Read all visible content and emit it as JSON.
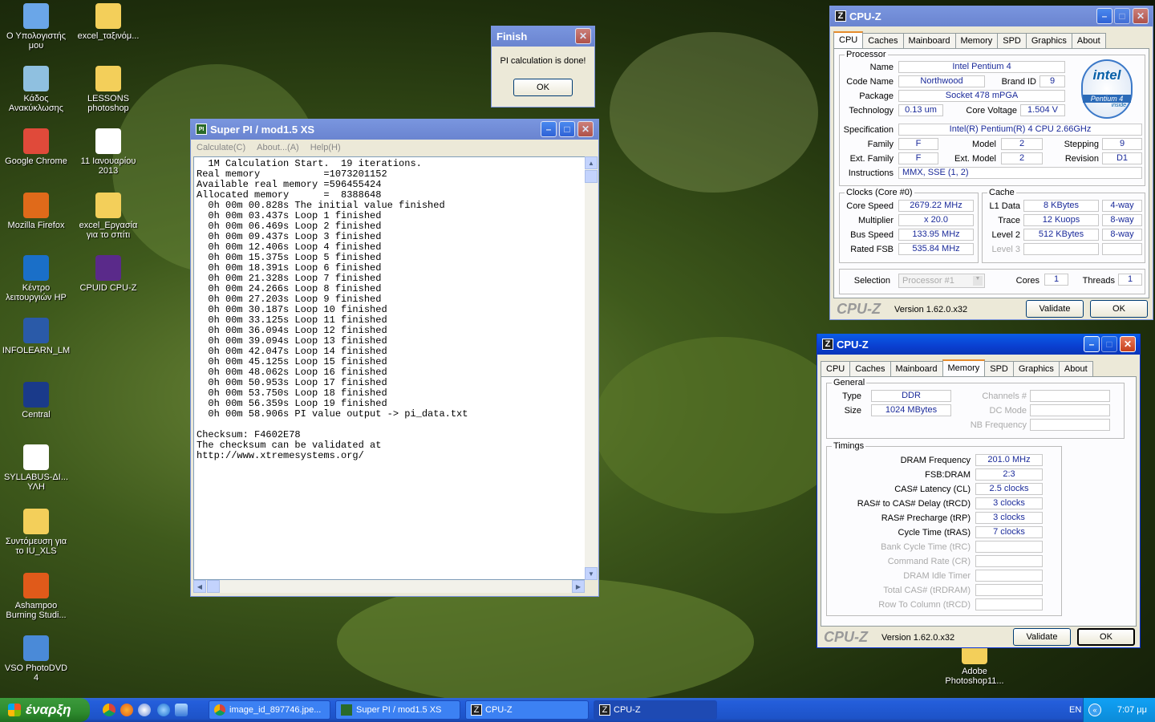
{
  "desktop_icons": [
    {
      "label": "Ο Υπολογιστής μου",
      "icon": "computer-icon",
      "color": "#6aa6e8"
    },
    {
      "label": "excel_ταξινόμ...",
      "icon": "folder-icon",
      "color": "#f3cf5a"
    },
    {
      "label": "Κάδος Ανακύκλωσης",
      "icon": "recycle-bin-icon",
      "color": "#8fc0e0"
    },
    {
      "label": "LESSONS photoshop",
      "icon": "folder-icon",
      "color": "#f3cf5a"
    },
    {
      "label": "Google Chrome",
      "icon": "chrome-icon",
      "color": "#e04a3a"
    },
    {
      "label": "11 Ιανουαρίου 2013",
      "icon": "pdf-icon",
      "color": "#ffffff"
    },
    {
      "label": "Mozilla Firefox",
      "icon": "firefox-icon",
      "color": "#e06a1a"
    },
    {
      "label": "excel_Εργασία για το σπίτι",
      "icon": "folder-icon",
      "color": "#f3cf5a"
    },
    {
      "label": "Κέντρο λειτουργιών HP",
      "icon": "hp-icon",
      "color": "#1a6fc8"
    },
    {
      "label": "CPUID CPU-Z",
      "icon": "cpuz-icon",
      "color": "#5a2a8a"
    },
    {
      "label": "INFOLEARN_LM",
      "icon": "plug-icon",
      "color": "#2a5aa8"
    },
    {
      "label": "Central",
      "icon": "star-icon",
      "color": "#1a3a8a"
    },
    {
      "label": "SYLLABUS-ΔΙ... ΥΛΗ",
      "icon": "excel-file-icon",
      "color": "#ffffff"
    },
    {
      "label": "Συντόμευση για το IU_XLS",
      "icon": "folder-shortcut-icon",
      "color": "#f3cf5a"
    },
    {
      "label": "Ashampoo Burning Studi...",
      "icon": "ashampoo-icon",
      "color": "#e05a1a"
    },
    {
      "label": "VSO PhotoDVD 4",
      "icon": "photodvd-icon",
      "color": "#4a8ad8"
    },
    {
      "label": "Adobe Photoshop11...",
      "icon": "photoshop-icon",
      "color": "#f3cf5a"
    }
  ],
  "finish_dialog": {
    "title": "Finish",
    "message": "PI calculation is done!",
    "ok": "OK"
  },
  "superpi": {
    "title": "Super PI / mod1.5 XS",
    "menu": [
      "Calculate(C)",
      "About...(A)",
      "Help(H)"
    ],
    "output": "  1M Calculation Start.  19 iterations.\nReal memory           =1073201152\nAvailable real memory =596455424\nAllocated memory      =  8388648\n  0h 00m 00.828s The initial value finished\n  0h 00m 03.437s Loop 1 finished\n  0h 00m 06.469s Loop 2 finished\n  0h 00m 09.437s Loop 3 finished\n  0h 00m 12.406s Loop 4 finished\n  0h 00m 15.375s Loop 5 finished\n  0h 00m 18.391s Loop 6 finished\n  0h 00m 21.328s Loop 7 finished\n  0h 00m 24.266s Loop 8 finished\n  0h 00m 27.203s Loop 9 finished\n  0h 00m 30.187s Loop 10 finished\n  0h 00m 33.125s Loop 11 finished\n  0h 00m 36.094s Loop 12 finished\n  0h 00m 39.094s Loop 13 finished\n  0h 00m 42.047s Loop 14 finished\n  0h 00m 45.125s Loop 15 finished\n  0h 00m 48.062s Loop 16 finished\n  0h 00m 50.953s Loop 17 finished\n  0h 00m 53.750s Loop 18 finished\n  0h 00m 56.359s Loop 19 finished\n  0h 00m 58.906s PI value output -> pi_data.txt\n\nChecksum: F4602E78\nThe checksum can be validated at\nhttp://www.xtremesystems.org/"
  },
  "cpuz_cpu": {
    "title": "CPU-Z",
    "tabs": [
      "CPU",
      "Caches",
      "Mainboard",
      "Memory",
      "SPD",
      "Graphics",
      "About"
    ],
    "processor_group": "Processor",
    "name_label": "Name",
    "name": "Intel Pentium 4",
    "codename_label": "Code Name",
    "codename": "Northwood",
    "brandid_label": "Brand ID",
    "brandid": "9",
    "package_label": "Package",
    "package": "Socket 478 mPGA",
    "technology_label": "Technology",
    "technology": "0.13 um",
    "corevoltage_label": "Core Voltage",
    "corevoltage": "1.504 V",
    "spec_label": "Specification",
    "spec": "Intel(R) Pentium(R) 4 CPU 2.66GHz",
    "family_label": "Family",
    "family": "F",
    "model_label": "Model",
    "model": "2",
    "stepping_label": "Stepping",
    "stepping": "9",
    "extfamily_label": "Ext. Family",
    "extfamily": "F",
    "extmodel_label": "Ext. Model",
    "extmodel": "2",
    "revision_label": "Revision",
    "revision": "D1",
    "instructions_label": "Instructions",
    "instructions": "MMX, SSE (1, 2)",
    "logo_line1": "intel",
    "logo_line2": "Pentium 4",
    "logo_line3": "inside",
    "clocks_group": "Clocks (Core #0)",
    "corespeed_label": "Core Speed",
    "corespeed": "2679.22 MHz",
    "multiplier_label": "Multiplier",
    "multiplier": "x 20.0",
    "busspeed_label": "Bus Speed",
    "busspeed": "133.95 MHz",
    "ratedfsb_label": "Rated FSB",
    "ratedfsb": "535.84 MHz",
    "cache_group": "Cache",
    "l1data_label": "L1 Data",
    "l1data": "8 KBytes",
    "l1data_way": "4-way",
    "trace_label": "Trace",
    "trace": "12 Kuops",
    "trace_way": "8-way",
    "level2_label": "Level 2",
    "level2": "512 KBytes",
    "level2_way": "8-way",
    "level3_label": "Level 3",
    "selection_label": "Selection",
    "selection": "Processor #1",
    "cores_label": "Cores",
    "cores": "1",
    "threads_label": "Threads",
    "threads": "1",
    "brand": "CPU-Z",
    "version": "Version 1.62.0.x32",
    "validate": "Validate",
    "ok": "OK"
  },
  "cpuz_mem": {
    "title": "CPU-Z",
    "tabs": [
      "CPU",
      "Caches",
      "Mainboard",
      "Memory",
      "SPD",
      "Graphics",
      "About"
    ],
    "general_group": "General",
    "type_label": "Type",
    "type": "DDR",
    "size_label": "Size",
    "size": "1024 MBytes",
    "channels_label": "Channels #",
    "dcmode_label": "DC Mode",
    "nbfreq_label": "NB Frequency",
    "timings_group": "Timings",
    "timings": [
      {
        "label": "DRAM Frequency",
        "value": "201.0 MHz",
        "enabled": true
      },
      {
        "label": "FSB:DRAM",
        "value": "2:3",
        "enabled": true
      },
      {
        "label": "CAS# Latency (CL)",
        "value": "2.5 clocks",
        "enabled": true
      },
      {
        "label": "RAS# to CAS# Delay (tRCD)",
        "value": "3 clocks",
        "enabled": true
      },
      {
        "label": "RAS# Precharge (tRP)",
        "value": "3 clocks",
        "enabled": true
      },
      {
        "label": "Cycle Time (tRAS)",
        "value": "7 clocks",
        "enabled": true
      },
      {
        "label": "Bank Cycle Time (tRC)",
        "value": "",
        "enabled": false
      },
      {
        "label": "Command Rate (CR)",
        "value": "",
        "enabled": false
      },
      {
        "label": "DRAM Idle Timer",
        "value": "",
        "enabled": false
      },
      {
        "label": "Total CAS# (tRDRAM)",
        "value": "",
        "enabled": false
      },
      {
        "label": "Row To Column (tRCD)",
        "value": "",
        "enabled": false
      }
    ],
    "brand": "CPU-Z",
    "version": "Version 1.62.0.x32",
    "validate": "Validate",
    "ok": "OK"
  },
  "taskbar": {
    "start": "έναρξη",
    "tasks": [
      "image_id_897746.jpe...",
      "Super PI / mod1.5 XS",
      "CPU-Z",
      "CPU-Z"
    ],
    "lang": "EN",
    "clock": "7:07 μμ"
  }
}
